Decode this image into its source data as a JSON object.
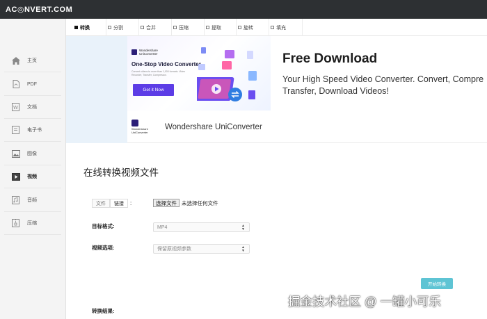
{
  "header": {
    "logo_text": "AC◎NVERT.COM"
  },
  "sidebar": {
    "items": [
      {
        "label": "主页",
        "icon": "home-icon"
      },
      {
        "label": "PDF",
        "icon": "pdf-file-icon"
      },
      {
        "label": "文档",
        "icon": "word-doc-icon"
      },
      {
        "label": "电子书",
        "icon": "ebook-icon"
      },
      {
        "label": "图像",
        "icon": "image-icon"
      },
      {
        "label": "视频",
        "icon": "video-icon",
        "active": true
      },
      {
        "label": "音频",
        "icon": "audio-icon"
      },
      {
        "label": "压缩",
        "icon": "archive-icon"
      }
    ]
  },
  "tabs": [
    {
      "label": "转换",
      "active": true
    },
    {
      "label": "分割"
    },
    {
      "label": "合并"
    },
    {
      "label": "压缩"
    },
    {
      "label": "提取"
    },
    {
      "label": "旋转"
    },
    {
      "label": "填充"
    }
  ],
  "ad": {
    "brand_line1": "Wondershare",
    "brand_line2": "UniConverter",
    "image_heading": "One-Stop Video Converter",
    "image_sub": "Convert videos to more than 1,000 formats. Video Recorder, Transfer, Compressor.",
    "image_button": "Get it Now",
    "footer_name": "Wondershare UniConverter",
    "title": "Free Download",
    "description_line1": "Your High Speed Video Converter. Convert, Compre",
    "description_line2": "Transfer, Download Videos!"
  },
  "form": {
    "title": "在线转换视频文件",
    "source_tabs": [
      "文件",
      "链接"
    ],
    "source_colon": ":",
    "file_button": "选择文件",
    "file_status": "未选择任何文件",
    "target_format_label": "目标格式:",
    "target_format_value": "MP4",
    "video_option_label": "视频选项:",
    "video_option_value": "保留原视频参数",
    "start_button": "开始转换",
    "result_label": "转换结果:"
  },
  "watermark": "掘金技术社区 @ 一罐小可乐",
  "colors": {
    "topbar": "#2d3033",
    "accent_button": "#5ec4d4",
    "ad_button": "#5c3ce6",
    "brand_dark": "#2b1e78"
  }
}
